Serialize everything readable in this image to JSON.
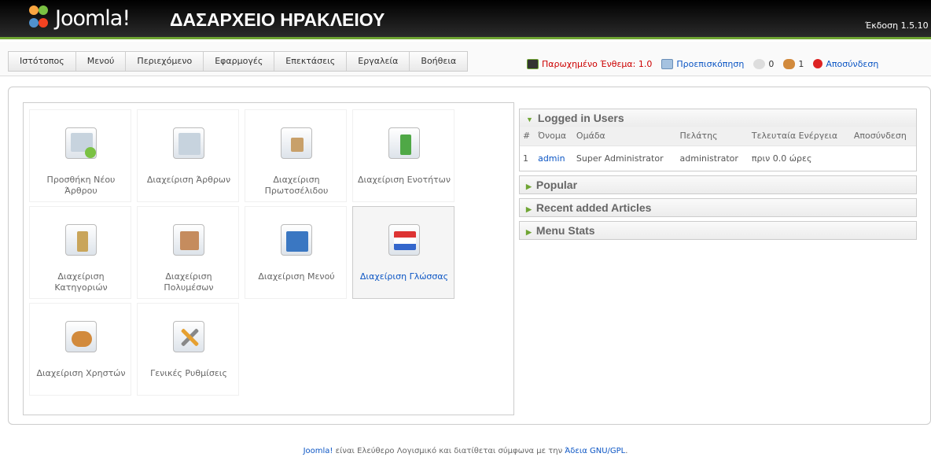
{
  "header": {
    "logo_text": "Joomla!",
    "site_title": "ΔΑΣΑΡΧΕΙΟ ΗΡΑΚΛΕΙΟΥ",
    "version": "Έκδοση 1.5.10"
  },
  "menu": [
    "Ιστότοπος",
    "Μενού",
    "Περιεχόμενο",
    "Εφαρμογές",
    "Επεκτάσεις",
    "Εργαλεία",
    "Βοήθεια"
  ],
  "status": {
    "checked_out": "Παρωχημένο Ένθεμα: 1.0",
    "preview": "Προεπισκόπηση",
    "messages": "0",
    "users": "1",
    "logout": "Αποσύνδεση"
  },
  "tiles": [
    "Προσθήκη Νέου Άρθρου",
    "Διαχείριση Άρθρων",
    "Διαχείριση Πρωτοσέλιδου",
    "Διαχείριση Ενοτήτων",
    "Διαχείριση Κατηγοριών",
    "Διαχείριση Πολυμέσων",
    "Διαχείριση Μενού",
    "Διαχείριση Γλώσσας",
    "Διαχείριση Χρηστών",
    "Γενικές Ρυθμίσεις"
  ],
  "logged_in": {
    "title": "Logged in Users",
    "columns": [
      "#",
      "Όνομα",
      "Ομάδα",
      "Πελάτης",
      "Τελευταία Ενέργεια",
      "Αποσύνδεση"
    ],
    "rows": [
      [
        "1",
        "admin",
        "Super Administrator",
        "administrator",
        "πριν 0.0 ώρες",
        ""
      ]
    ]
  },
  "panels": [
    "Popular",
    "Recent added Articles",
    "Menu Stats"
  ],
  "footer": {
    "joomla": "Joomla!",
    "text": " είναι Ελεύθερο Λογισμικό και διατίθεται σύμφωνα με την ",
    "license": "Άδεια GNU/GPL",
    "end": "."
  },
  "colors": {
    "accent_green": "#6fa533",
    "link_blue": "#0b55c4"
  }
}
